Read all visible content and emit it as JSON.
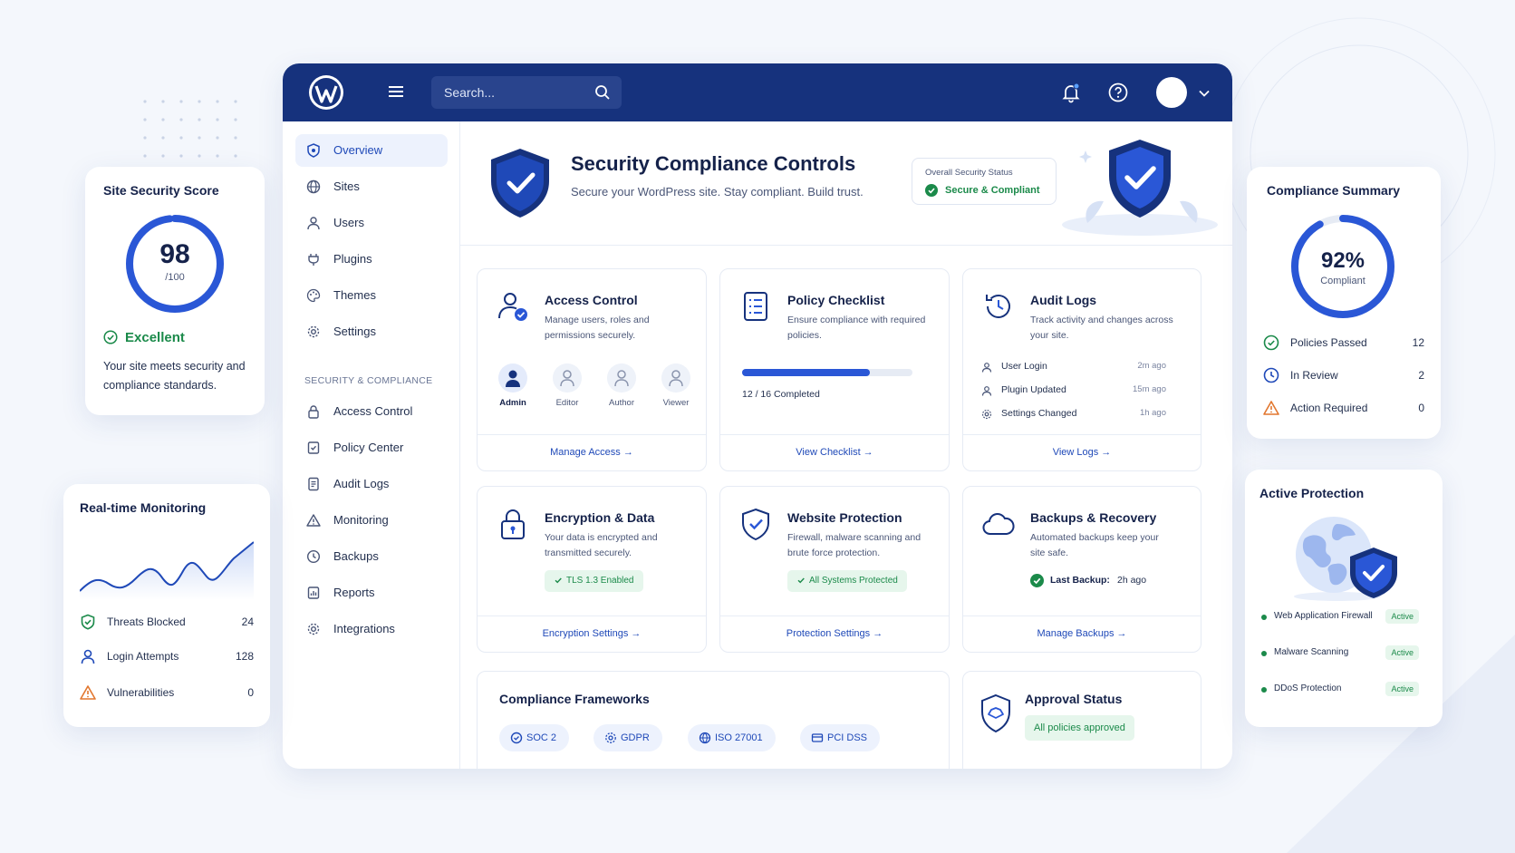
{
  "app": {
    "search": {
      "placeholder": "Search..."
    },
    "sidebar": {
      "items": [
        {
          "label": "Overview",
          "icon": "shield-icon",
          "active": true
        },
        {
          "label": "Sites",
          "icon": "globe-icon"
        },
        {
          "label": "Users",
          "icon": "user-icon"
        },
        {
          "label": "Plugins",
          "icon": "plug-icon"
        },
        {
          "label": "Themes",
          "icon": "palette-icon"
        },
        {
          "label": "Settings",
          "icon": "gear-icon"
        }
      ],
      "section_label": "SECURITY & COMPLIANCE",
      "security_items": [
        {
          "label": "Access Control",
          "icon": "lock-icon"
        },
        {
          "label": "Policy Center",
          "icon": "policy-icon"
        },
        {
          "label": "Audit Logs",
          "icon": "document-icon"
        },
        {
          "label": "Monitoring",
          "icon": "alert-triangle-icon"
        },
        {
          "label": "Backups",
          "icon": "clock-icon"
        },
        {
          "label": "Reports",
          "icon": "report-icon"
        },
        {
          "label": "Integrations",
          "icon": "gear-icon"
        }
      ]
    },
    "header": {
      "title": "Security Compliance Controls",
      "subtitle": "Secure your WordPress site. Stay compliant. Build trust.",
      "status_title": "Overall Security Status",
      "status_value": "Secure & Compliant"
    },
    "modules": {
      "access": {
        "title": "Access Control",
        "desc": "Manage users, roles and permissions securely.",
        "roles": [
          "Admin",
          "Editor",
          "Author",
          "Viewer"
        ],
        "link": "Manage Access"
      },
      "policy": {
        "title": "Policy Checklist",
        "desc": "Ensure compliance with required policies.",
        "completed": 12,
        "total": 16,
        "progress_text": "12 / 16 Completed",
        "link": "View Checklist"
      },
      "audit": {
        "title": "Audit Logs",
        "desc": "Track activity and changes across your site.",
        "rows": [
          {
            "text": "User Login",
            "time": "2m ago",
            "icon": "user-icon"
          },
          {
            "text": "Plugin Updated",
            "time": "15m ago",
            "icon": "user-icon"
          },
          {
            "text": "Settings Changed",
            "time": "1h ago",
            "icon": "gear-icon"
          }
        ],
        "link": "View Logs"
      },
      "encryption": {
        "title": "Encryption & Data",
        "desc": "Your data is encrypted and transmitted securely.",
        "badge": "TLS 1.3 Enabled",
        "link": "Encryption Settings"
      },
      "protection": {
        "title": "Website Protection",
        "desc": "Firewall, malware scanning and brute force protection.",
        "badge": "All Systems Protected",
        "link": "Protection Settings"
      },
      "backups": {
        "title": "Backups & Recovery",
        "desc": "Automated backups keep your site safe.",
        "last_label": "Last Backup:",
        "last_value": "2h ago",
        "link": "Manage Backups"
      },
      "frameworks": {
        "title": "Compliance Frameworks",
        "items": [
          "SOC 2",
          "GDPR",
          "ISO 27001",
          "PCI DSS"
        ]
      },
      "approval": {
        "title": "Approval Status",
        "badge": "All policies approved"
      }
    }
  },
  "score_widget": {
    "title": "Site Security Score",
    "score": "98",
    "out_of": "/100",
    "score_fraction": 0.98,
    "rating": "Excellent",
    "desc": "Your site meets security and compliance standards."
  },
  "monitoring_widget": {
    "title": "Real-time Monitoring",
    "stats": [
      {
        "label": "Threats Blocked",
        "value": "24",
        "icon": "shield-check-icon",
        "color": "#1b8a4a"
      },
      {
        "label": "Login Attempts",
        "value": "128",
        "icon": "user-icon",
        "color": "#1f49b8"
      },
      {
        "label": "Vulnerabilities",
        "value": "0",
        "icon": "alert-triangle-icon",
        "color": "#e2772f"
      }
    ]
  },
  "compliance_widget": {
    "title": "Compliance Summary",
    "percent": "92%",
    "percent_fraction": 0.92,
    "percent_label": "Compliant",
    "stats": [
      {
        "label": "Policies Passed",
        "value": "12",
        "icon": "check-circle-icon",
        "color": "#1b8a4a"
      },
      {
        "label": "In Review",
        "value": "2",
        "icon": "clock-icon",
        "color": "#1f49b8"
      },
      {
        "label": "Action Required",
        "value": "0",
        "icon": "alert-triangle-icon",
        "color": "#e2772f"
      }
    ]
  },
  "protection_widget": {
    "title": "Active Protection",
    "items": [
      {
        "label": "Web Application Firewall",
        "status": "Active"
      },
      {
        "label": "Malware Scanning",
        "status": "Active"
      },
      {
        "label": "DDoS Protection",
        "status": "Active"
      }
    ]
  },
  "colors": {
    "primary": "#16327d",
    "accent": "#1f49b8",
    "success": "#1b8a4a",
    "warning": "#e2772f"
  }
}
